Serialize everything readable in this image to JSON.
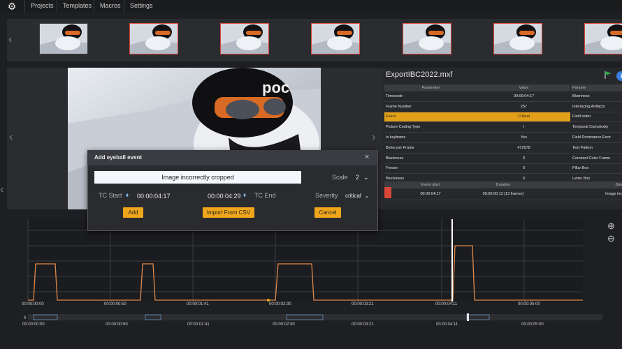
{
  "nav": {
    "items": [
      "Projects",
      "Templates",
      "Macros",
      "Settings"
    ]
  },
  "panel": {
    "title": "ExportIBC2022.mxf",
    "param_header": "Parameter",
    "value_header": "Value",
    "params": [
      {
        "name": "Timecode",
        "value": "00:00:04:17"
      },
      {
        "name": "Frame Number",
        "value": "257"
      },
      {
        "name": "Event",
        "value": "Critical"
      },
      {
        "name": "Picture Coding Type",
        "value": "I"
      },
      {
        "name": "Is keyframe",
        "value": "Yes"
      },
      {
        "name": "Bytes per Frame",
        "value": "472578"
      },
      {
        "name": "Blackness",
        "value": "0"
      },
      {
        "name": "Freeze",
        "value": "0"
      },
      {
        "name": "Blockiness",
        "value": "0"
      }
    ],
    "right_params": [
      "Blurriness",
      "Interlacing Artifacts",
      "Field order",
      "Temporal Complexity",
      "Field Dominance Error",
      "Test Pattern",
      "Constant Color Frame",
      "Pillar Box",
      "Letter Box"
    ],
    "right_header": "Parame",
    "events_headers": [
      "Event start",
      "Duration",
      "Desc"
    ],
    "events": [
      {
        "start": "00:00:04:17",
        "duration": "00:00:00:13 (13 frames)",
        "desc": "Image inco"
      }
    ]
  },
  "dialog": {
    "title": "Add eyeball event",
    "event_text": "Image incorrectly cropped",
    "scale_label": "Scale",
    "scale_value": "2",
    "tc_start_label": "TC Start",
    "tc_start_value": "00:00:04:17",
    "tc_end_value": "00:00:04:29",
    "tc_end_label": "TC End",
    "severity_label": "Severity",
    "severity_value": "critical",
    "add_label": "Add",
    "import_label": "Import From CSV",
    "cancel_label": "Cancel",
    "close_glyph": "×"
  },
  "timeline": {
    "ticks": [
      "00:00:00:00",
      "00:00:00:50",
      "00:00:01:41",
      "00:00:02:30",
      "00:00:03:21",
      "00:00:04:11",
      "00:00:05:00"
    ],
    "overview_ticks": [
      "00:00:00:00",
      "00:00:00:50",
      "00:00:01:41",
      "00:00:02:30",
      "00:00:03:21",
      "00:00:04:11",
      "00:00:05:00"
    ],
    "overview_zero": "0"
  },
  "colors": {
    "accent": "#f0a61c",
    "critical": "#d9463a",
    "plot_line": "#e0894a"
  }
}
